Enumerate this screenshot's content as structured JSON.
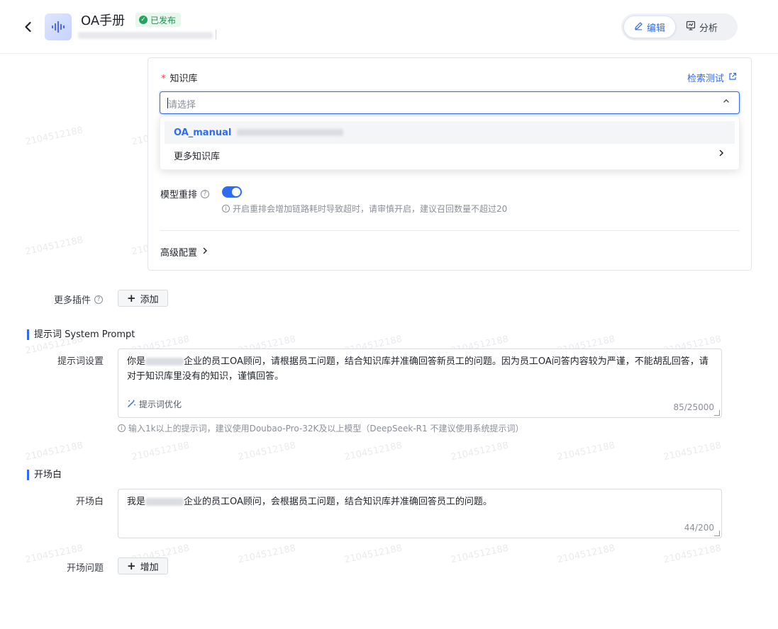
{
  "header": {
    "back_icon": "chevron-left-icon",
    "app_icon": "waveform-icon",
    "title": "OA手册",
    "status": "已发布",
    "status_color": "#22a45d",
    "tabs": [
      {
        "label": "编辑",
        "icon": "pencil-icon",
        "active": true
      },
      {
        "label": "分析",
        "icon": "chart-icon",
        "active": false
      }
    ]
  },
  "watermark": "2104512188",
  "knowledge": {
    "label": "知识库",
    "test_link": "检索测试",
    "select_placeholder": "请选择",
    "options": [
      {
        "label": "OA_manual",
        "selected": true
      },
      {
        "label": "更多知识库",
        "selected": false
      }
    ],
    "rerank_label": "模型重排",
    "rerank_enabled": true,
    "rerank_hint": "开启重排会增加链路耗时导致超时，请审慎开启，建议召回数量不超过20",
    "advanced_label": "高级配置"
  },
  "plugins": {
    "label": "更多插件",
    "add_label": "添加"
  },
  "prompt_section": {
    "title": "提示词 System Prompt",
    "field_label": "提示词设置",
    "text_prefix": "你是",
    "text_rest": "企业的员工OA顾问，请根据员工问题，结合知识库并准确回答新员工的问题。因为员工OA问答内容较为严谨，不能胡乱回答，请对于知识库里没有的知识，谨慎回答。",
    "optimize_label": "提示词优化",
    "count": "85/25000",
    "hint": "输入1k以上的提示词，建议使用Doubao-Pro-32K及以上模型（DeepSeek-R1 不建议使用系统提示词）"
  },
  "opening_section": {
    "title": "开场白",
    "field_label": "开场白",
    "text_prefix": "我是",
    "text_rest": "企业的员工OA顾问，会根据员工问题，结合知识库并准确回答员工的问题。",
    "count": "44/200",
    "questions_label": "开场问题",
    "add_label": "增加"
  }
}
